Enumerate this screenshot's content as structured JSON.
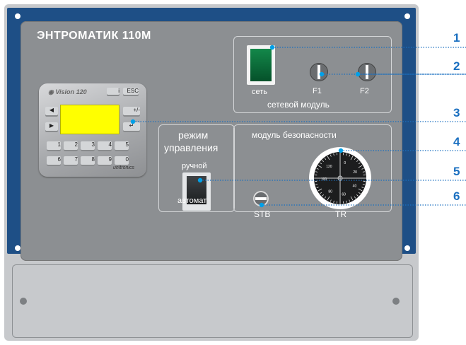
{
  "title": "ЭНТРОМАТИК 110М",
  "network_module": {
    "label": "сетевой модуль",
    "switch_label": "сеть",
    "fuse1_label": "F1",
    "fuse2_label": "F2"
  },
  "mode": {
    "title_line1": "режим",
    "title_line2": "управления",
    "manual_label": "ручной",
    "auto_label": "автомат"
  },
  "safety_module": {
    "label": "модуль безопасности",
    "stb_label": "STB",
    "tr_label": "TR",
    "dial_labels": [
      "0",
      "20",
      "40",
      "60",
      "80",
      "100",
      "120"
    ]
  },
  "controller": {
    "brand": "Vision",
    "model": "120",
    "esc_key": "ESC",
    "pm_key": "+/-",
    "keys": [
      "1",
      "2",
      "3",
      "4",
      "5",
      "6",
      "7",
      "8",
      "9",
      "0"
    ],
    "footer_brand": "unitronics"
  },
  "callouts": [
    "1",
    "2",
    "3",
    "4",
    "5",
    "6"
  ],
  "colors": {
    "panel_blue": "#1e4f86",
    "panel_grey": "#8c8f92",
    "switch_green": "#0a6e3a",
    "display_yellow": "#ffff00",
    "callout_blue": "#1a6fc0"
  }
}
